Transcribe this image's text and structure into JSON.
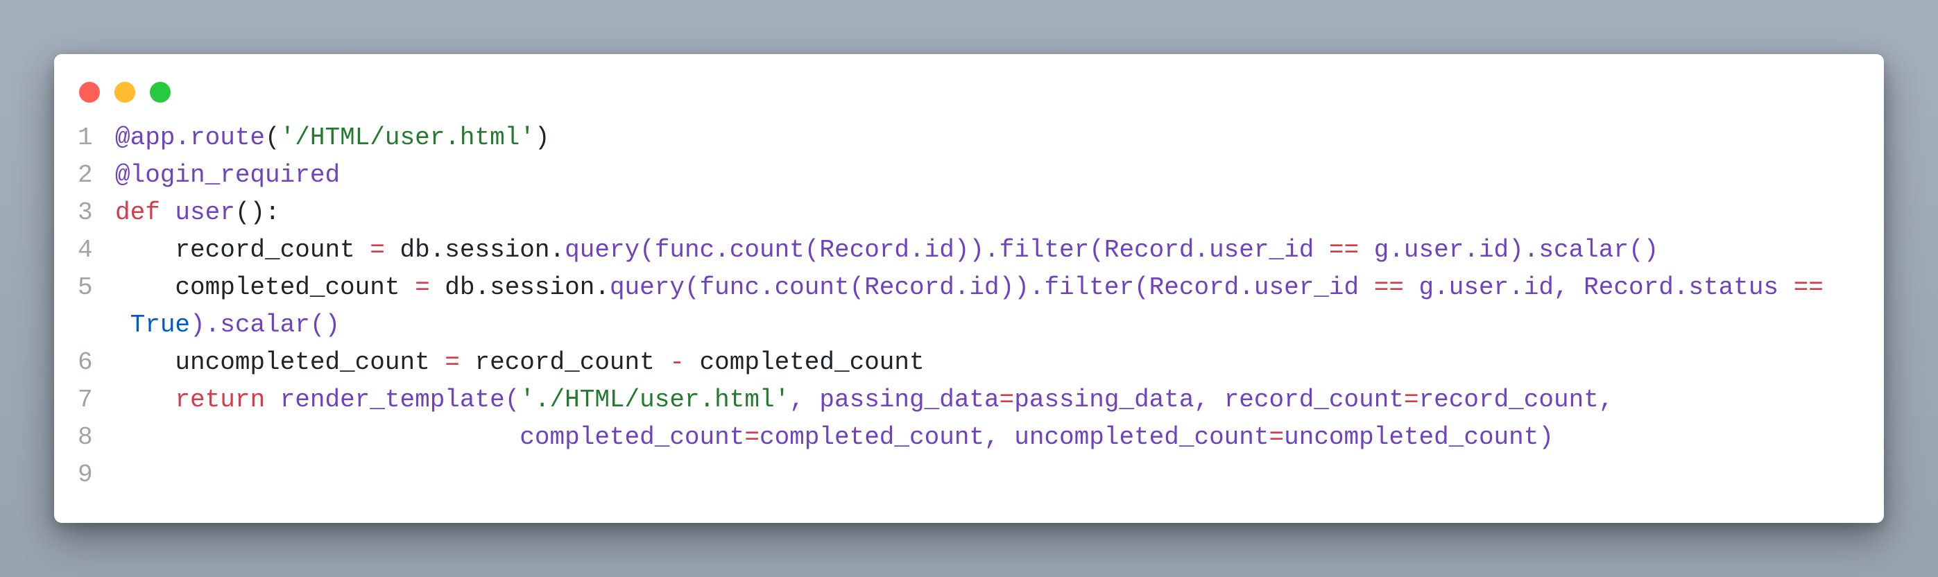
{
  "window": {
    "controls": {
      "close_color": "#ff5f57",
      "minimize_color": "#febc2e",
      "maximize_color": "#28c840"
    }
  },
  "code": {
    "language": "python",
    "lines": [
      {
        "number": "1",
        "tokens": [
          {
            "type": "decorator",
            "text": "@app.route"
          },
          {
            "type": "plain",
            "text": "("
          },
          {
            "type": "string",
            "text": "'/HTML/user.html'"
          },
          {
            "type": "plain",
            "text": ")"
          }
        ]
      },
      {
        "number": "2",
        "tokens": [
          {
            "type": "decorator",
            "text": "@login_required"
          }
        ]
      },
      {
        "number": "3",
        "tokens": [
          {
            "type": "keyword",
            "text": "def "
          },
          {
            "type": "func",
            "text": "user"
          },
          {
            "type": "plain",
            "text": "():"
          }
        ]
      },
      {
        "number": "4",
        "tokens": [
          {
            "type": "plain",
            "text": "    record_count "
          },
          {
            "type": "op",
            "text": "="
          },
          {
            "type": "plain",
            "text": " db.session."
          },
          {
            "type": "func",
            "text": "query(func.count(Record.id)).filter(Record.user_id "
          },
          {
            "type": "op",
            "text": "=="
          },
          {
            "type": "func",
            "text": " g.user.id).scalar()"
          }
        ]
      },
      {
        "number": "5",
        "tokens": [
          {
            "type": "plain",
            "text": "    completed_count "
          },
          {
            "type": "op",
            "text": "="
          },
          {
            "type": "plain",
            "text": " db.session."
          },
          {
            "type": "func",
            "text": "query(func.count(Record.id)).filter(Record.user_id "
          },
          {
            "type": "op",
            "text": "=="
          },
          {
            "type": "func",
            "text": " g.user.id, Record.status "
          },
          {
            "type": "op",
            "text": "=="
          }
        ]
      },
      {
        "number": "",
        "tokens": [
          {
            "type": "plain",
            "text": " "
          },
          {
            "type": "builtin",
            "text": "True"
          },
          {
            "type": "func",
            "text": ").scalar()"
          }
        ]
      },
      {
        "number": "6",
        "tokens": [
          {
            "type": "plain",
            "text": "    uncompleted_count "
          },
          {
            "type": "op",
            "text": "="
          },
          {
            "type": "plain",
            "text": " record_count "
          },
          {
            "type": "op",
            "text": "-"
          },
          {
            "type": "plain",
            "text": " completed_count"
          }
        ]
      },
      {
        "number": "7",
        "tokens": [
          {
            "type": "plain",
            "text": "    "
          },
          {
            "type": "keyword",
            "text": "return"
          },
          {
            "type": "plain",
            "text": " "
          },
          {
            "type": "func",
            "text": "render_template("
          },
          {
            "type": "string",
            "text": "'./HTML/user.html'"
          },
          {
            "type": "func",
            "text": ", passing_data"
          },
          {
            "type": "op",
            "text": "="
          },
          {
            "type": "func",
            "text": "passing_data, record_count"
          },
          {
            "type": "op",
            "text": "="
          },
          {
            "type": "func",
            "text": "record_count,"
          }
        ]
      },
      {
        "number": "8",
        "tokens": [
          {
            "type": "plain",
            "text": "                           "
          },
          {
            "type": "func",
            "text": "completed_count"
          },
          {
            "type": "op",
            "text": "="
          },
          {
            "type": "func",
            "text": "completed_count, uncompleted_count"
          },
          {
            "type": "op",
            "text": "="
          },
          {
            "type": "func",
            "text": "uncompleted_count)"
          }
        ]
      },
      {
        "number": "9",
        "tokens": []
      }
    ]
  }
}
